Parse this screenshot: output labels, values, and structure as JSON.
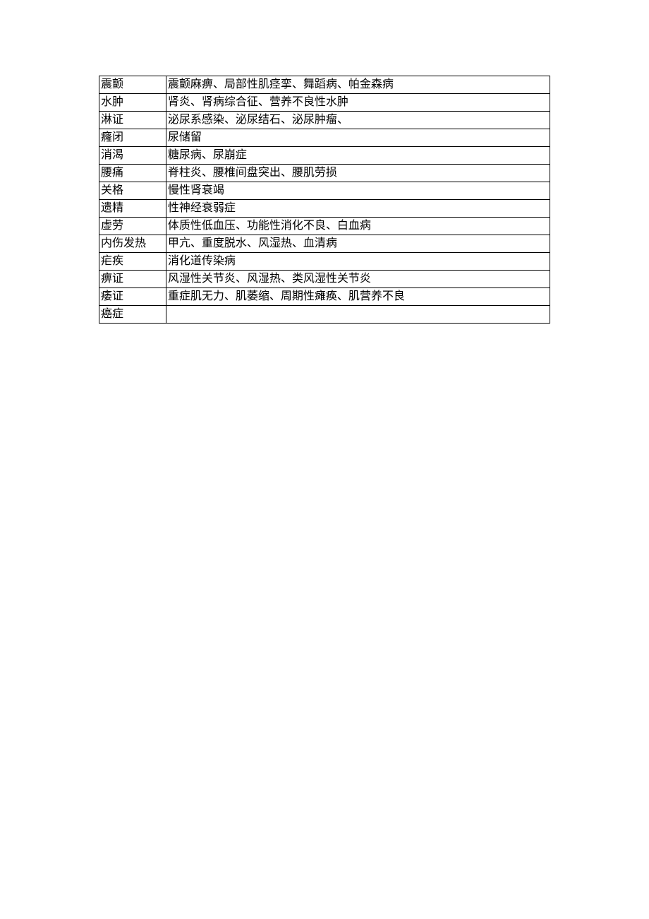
{
  "table": {
    "rows": [
      {
        "term": "震颤",
        "description": "震颤麻痹、局部性肌痉挛、舞蹈病、帕金森病"
      },
      {
        "term": "水肿",
        "description": "肾炎、肾病综合征、营养不良性水肿"
      },
      {
        "term": "淋证",
        "description": "泌尿系感染、泌尿结石、泌尿肿瘤、"
      },
      {
        "term": "癃闭",
        "description": "尿储留"
      },
      {
        "term": "消渴",
        "description": "糖尿病、尿崩症"
      },
      {
        "term": "腰痛",
        "description": "脊柱炎、腰椎间盘突出、腰肌劳损"
      },
      {
        "term": "关格",
        "description": "慢性肾衰竭"
      },
      {
        "term": "遗精",
        "description": "性神经衰弱症"
      },
      {
        "term": "虚劳",
        "description": "体质性低血压、功能性消化不良、白血病"
      },
      {
        "term": "内伤发热",
        "description": "甲亢、重度脱水、风湿热、血清病"
      },
      {
        "term": "疟疾",
        "description": "消化道传染病"
      },
      {
        "term": "痹证",
        "description": "风湿性关节炎、风湿热、类风湿性关节炎"
      },
      {
        "term": "痿证",
        "description": "重症肌无力、肌萎缩、周期性瘫痪、肌营养不良"
      },
      {
        "term": "癌症",
        "description": ""
      }
    ]
  }
}
